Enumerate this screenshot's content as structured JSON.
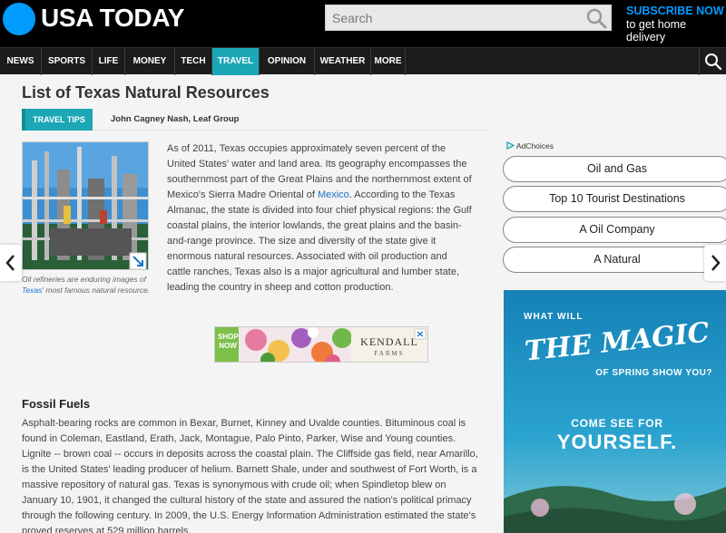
{
  "header": {
    "logo_text": "USA TODAY",
    "search_placeholder": "Search",
    "subscribe_line1": "SUBSCRIBE NOW",
    "subscribe_line2": "to get home delivery",
    "brand_color": "#009bff"
  },
  "nav": {
    "items": [
      {
        "label": "NEWS"
      },
      {
        "label": "SPORTS"
      },
      {
        "label": "LIFE"
      },
      {
        "label": "MONEY"
      },
      {
        "label": "TECH"
      },
      {
        "label": "TRAVEL",
        "active": true
      },
      {
        "label": "OPINION"
      },
      {
        "label": "WEATHER"
      },
      {
        "label": "MORE"
      }
    ],
    "active_color": "#1ba7b5"
  },
  "article": {
    "title": "List of Texas Natural Resources",
    "tag": "TRAVEL TIPS",
    "author": "John Cagney Nash, Leaf Group",
    "caption_before": "Oil refineries are enduring images of ",
    "caption_link": "Texas",
    "caption_after": "' most famous natural resource.",
    "intro_before": "As of 2011, Texas occupies approximately seven percent of the United States' water and land area. Its geography encompasses the southernmost part of the Great Plains and the northernmost extent of Mexico's Sierra Madre Oriental of ",
    "intro_link": "Mexico",
    "intro_after": ". According to the Texas Almanac, the state is divided into four chief physical regions: the Gulf coastal plains, the interior lowlands, the great plains and the basin-and-range province. The size and diversity of the state give it enormous natural resources. Associated with oil production and cattle ranches, Texas also is a major agricultural and lumber state, leading the country in sheep and cotton production.",
    "section_heading": "Fossil Fuels",
    "section_text": "Asphalt-bearing rocks are common in Bexar, Burnet, Kinney and Uvalde counties. Bituminous coal is found in Coleman, Eastland, Erath, Jack, Montague, Palo Pinto, Parker, Wise and Young counties. Lignite -- brown coal -- occurs in deposits across the coastal plain. The Cliffside gas field, near Amarillo, is the United States' leading producer of helium. Barnett Shale, under and southwest of Fort Worth, is a massive repository of natural gas. Texas is synonymous with crude oil; when Spindletop blew on January 10, 1901, it changed the cultural history of the state and assured the nation's political primacy through the following century. In 2009, the U.S. Energy Information Administration estimated the state's proved reserves at 529 million barrels."
  },
  "banner_ad": {
    "shop_line1": "SHOP",
    "shop_line2": "NOW",
    "brand_line1": "KENDALL",
    "brand_line2": "FARMS"
  },
  "sidebar": {
    "adchoices": "AdChoices",
    "links": [
      "Oil and Gas",
      "Top 10 Tourist Destinations",
      "A Oil Company",
      "A Natural"
    ],
    "ad": {
      "line1": "WHAT WILL",
      "line2": "THE MAGIC",
      "line3": "OF SPRING SHOW YOU?",
      "line4": "COME SEE FOR",
      "line5": "YOURSELF."
    }
  }
}
